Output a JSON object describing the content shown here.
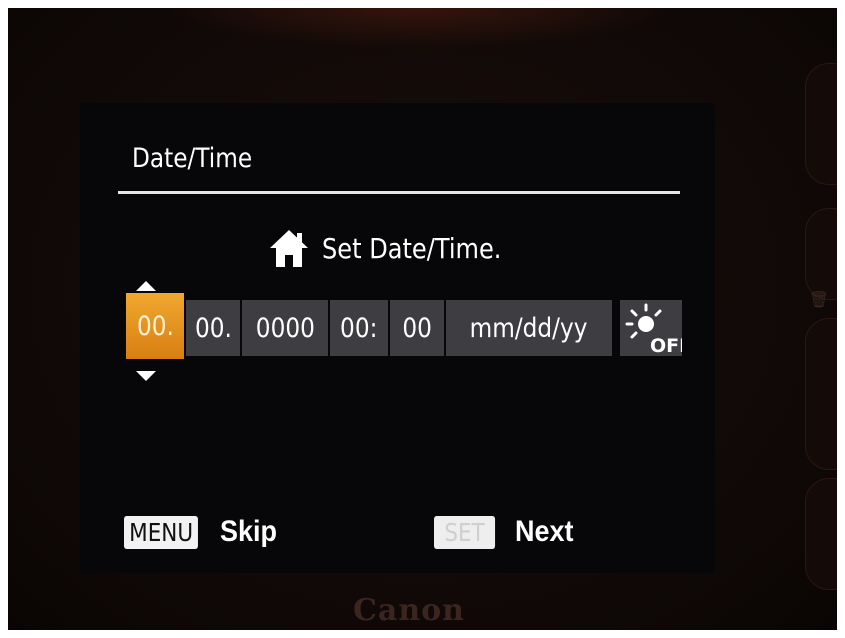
{
  "screen": {
    "title": "Date/Time",
    "prompt": "Set Date/Time.",
    "fields": {
      "month": "00.",
      "day": "00.",
      "year": "0000",
      "hour": "00:",
      "minute": "00",
      "format": "mm/dd/yy"
    },
    "daylight_saving": "OFF",
    "hints": {
      "skip_key": "MENU",
      "skip_label": "Skip",
      "next_key": "SET",
      "next_label": "Next"
    }
  },
  "device": {
    "brand": "Canon"
  },
  "colors": {
    "selected_field": "#e8921f",
    "field": "#3d3d42",
    "screen_bg": "#07070a"
  },
  "icons": [
    "home-icon",
    "up-arrow-icon",
    "down-arrow-icon",
    "sun-off-icon",
    "trash-icon"
  ]
}
